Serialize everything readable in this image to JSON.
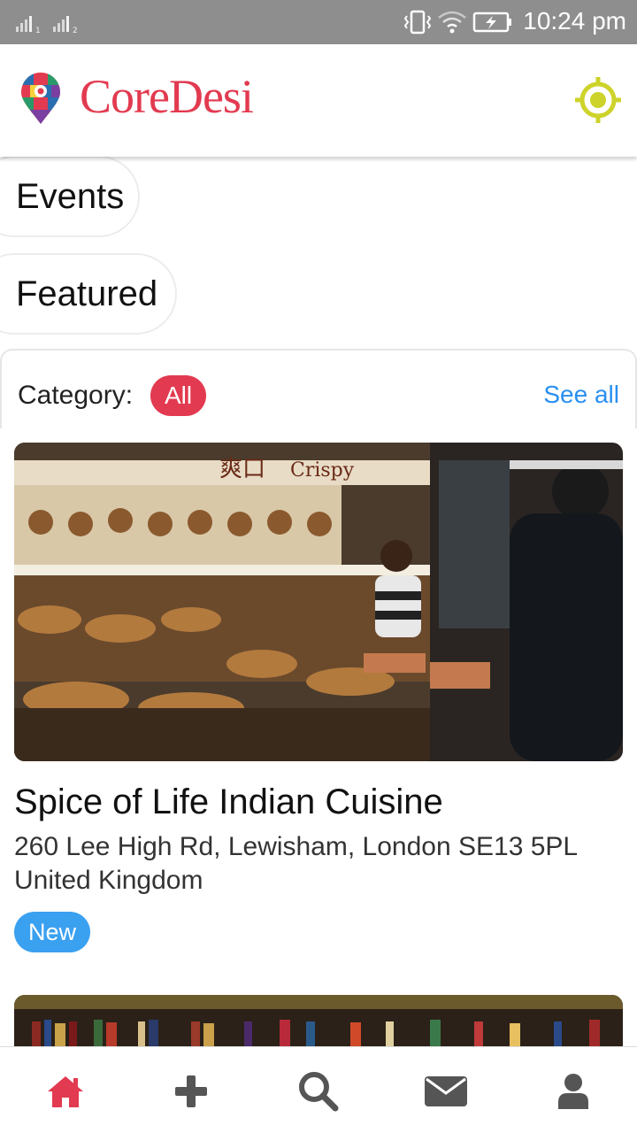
{
  "status_bar": {
    "time": "10:24 pm",
    "sim1": "1",
    "sim2": "2"
  },
  "header": {
    "brand": "CoreDesi",
    "brand_color": "#e23a50",
    "accent_color": "#cdd32a"
  },
  "pills": {
    "events": "Events",
    "featured": "Featured"
  },
  "category_bar": {
    "label": "Category:",
    "selected": "All",
    "see_all": "See all"
  },
  "listings": [
    {
      "title": "Spice of Life Indian Cuisine",
      "address": "260 Lee High Rd, Lewisham, London SE13 5PL United Kingdom",
      "badge": "New",
      "image_sign_1": "爽口",
      "image_sign_2": "Crispy"
    }
  ],
  "bottom_nav": {
    "items": [
      "home-icon",
      "plus-icon",
      "search-icon",
      "mail-icon",
      "user-icon"
    ],
    "active_color": "#e23a50",
    "inactive_color": "#555555"
  }
}
